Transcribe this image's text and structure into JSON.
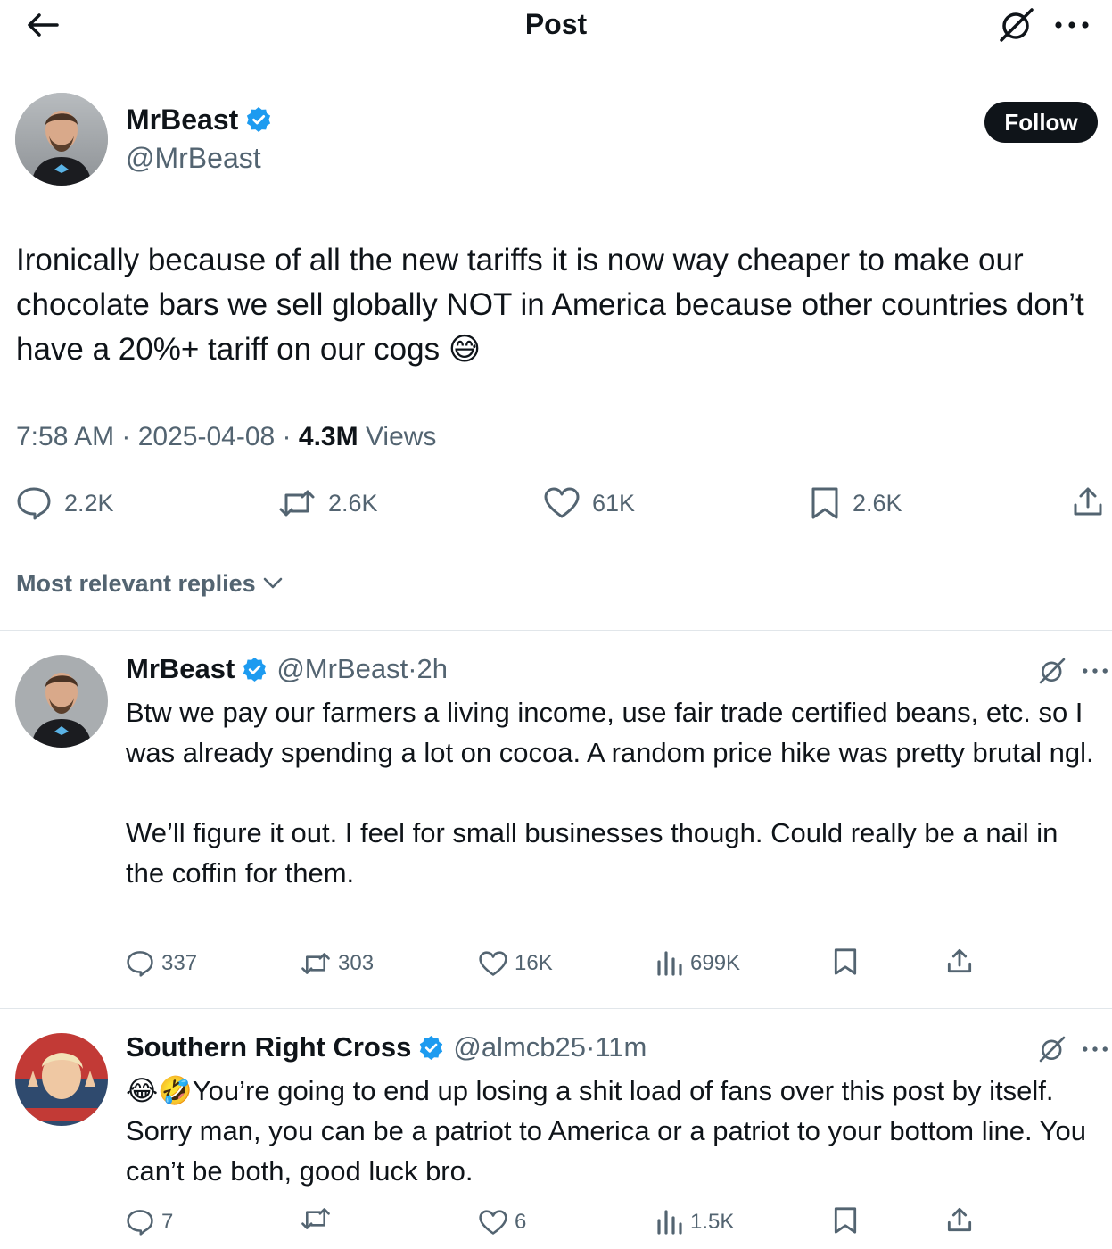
{
  "header": {
    "title": "Post",
    "back_icon": "arrow-left-icon",
    "grok_icon": "grok-icon",
    "more_icon": "more-horizontal-icon"
  },
  "post": {
    "author_name": "MrBeast",
    "author_handle": "@MrBeast",
    "verified": true,
    "follow_label": "Follow",
    "text": "Ironically because of all the new tariffs it is now way cheaper to make our chocolate bars we sell globally NOT in America because other countries don’t have a 20%+ tariff on our cogs 😅",
    "time": "7:58 AM",
    "date": "2025-04-08",
    "views_count": "4.3M",
    "views_label": "Views",
    "separator": " · ",
    "stats": {
      "replies": "2.2K",
      "reposts": "2.6K",
      "likes": "61K",
      "bookmarks": "2.6K"
    }
  },
  "replies_sort": {
    "label": "Most relevant replies"
  },
  "replies": [
    {
      "name": "MrBeast",
      "handle": "@MrBeast",
      "time": "2h",
      "text": "Btw we pay our farmers a living income, use fair trade certified beans, etc. so I was already spending a lot on cocoa. A random price hike was pretty brutal ngl.\n\nWe’ll figure it out. I feel for small businesses though. Could really be a nail in the coffin for them.",
      "stats": {
        "replies": "337",
        "reposts": "303",
        "likes": "16K",
        "views": "699K"
      }
    },
    {
      "name": "Southern Right Cross",
      "handle": "@almcb25",
      "time": "11m",
      "text": "😂🤣You’re going to end up losing a shit load of fans over this post by itself. Sorry man, you can be a patriot to America or a patriot to your bottom line. You can’t be both, good luck bro.",
      "stats": {
        "replies": "7",
        "reposts": "",
        "likes": "6",
        "views": "1.5K"
      }
    }
  ],
  "colors": {
    "text": "#0f1419",
    "secondary": "#536471",
    "verified": "#1d9bf0",
    "divider": "#e1e6ea"
  }
}
